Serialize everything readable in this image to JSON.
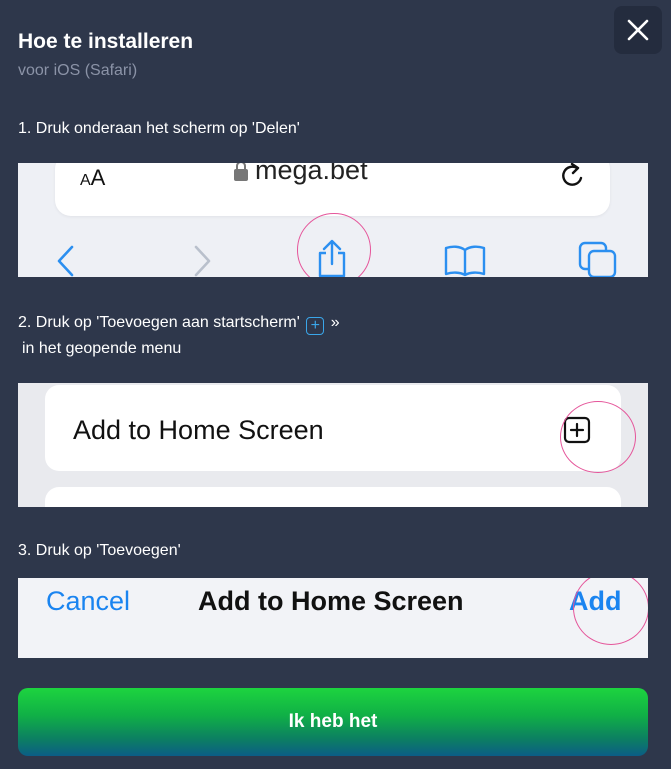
{
  "modal": {
    "title": "Hoe te installeren",
    "subtitle": "voor iOS (Safari)"
  },
  "steps": [
    {
      "text": "1. Druk onderaan het scherm op 'Delen'"
    },
    {
      "text_before": "2. Druk op 'Toevoegen aan startscherm'",
      "text_after": "»",
      "line2": "in het geopende menu"
    },
    {
      "text": "3. Druk op 'Toevoegen'"
    }
  ],
  "illustration1": {
    "aa_small": "A",
    "aa_large": "A",
    "url": "mega.bet",
    "icons": [
      "back-icon",
      "forward-icon",
      "share-icon",
      "bookmarks-icon",
      "tabs-icon",
      "reload-icon",
      "lock-icon"
    ]
  },
  "illustration2": {
    "menu_label": "Add to Home Screen",
    "icon": "plus-square-icon"
  },
  "illustration3": {
    "cancel": "Cancel",
    "title": "Add to Home Screen",
    "add": "Add"
  },
  "cta": {
    "label": "Ik heb het"
  },
  "colors": {
    "background": "#2e374b",
    "highlight_circle": "#e5559a",
    "ios_blue": "#1a84f0",
    "cta_green": "#1dd43f",
    "cta_blue": "#0b5d86"
  }
}
